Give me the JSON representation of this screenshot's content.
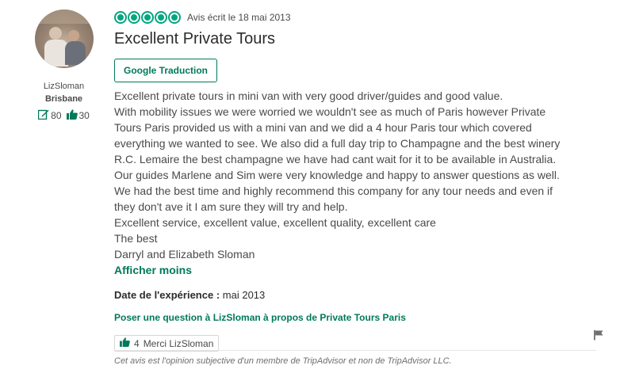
{
  "reviewer": {
    "username": "LizSloman",
    "location": "Brisbane",
    "review_count": "80",
    "helpful_count": "30"
  },
  "review": {
    "date_text": "Avis écrit le 18 mai 2013",
    "rating": 5,
    "title": "Excellent Private Tours",
    "translate_label": "Google Traduction",
    "body_lines": [
      "Excellent private tours in mini van with very good driver/guides and good value.",
      "With mobility issues we were worried we wouldn't see as much of Paris however Private",
      "Tours Paris provided us with a mini van and we did a 4 hour Paris tour which covered",
      "everything we wanted to see. We also did a full day trip to Champagne and the best winery",
      "R.C. Lemaire the best champagne we have had cant wait for it to be available in Australia.",
      "Our guides Marlene and Sim were very knowledge and happy to answer questions as well.",
      "We had the best time and highly recommend this company for any tour needs and even if",
      "they don't ave it I am sure they will try and help.",
      "Excellent service, excellent value, excellent quality, excellent care",
      "The best",
      "Darryl and Elizabeth Sloman"
    ],
    "show_less_label": "Afficher moins",
    "experience_label": "Date de l'expérience :",
    "experience_value": "mai 2013",
    "ask_question_label": "Poser une question à LizSloman à propos de Private Tours Paris",
    "helpful_votes": "4",
    "thank_label": "Merci LizSloman",
    "disclaimer": "Cet avis est l'opinion subjective d'un membre de TripAdvisor et non de TripAdvisor LLC."
  },
  "colors": {
    "accent": "#00a680",
    "link": "#00795a",
    "text": "#4a4a4a"
  },
  "icons": {
    "reviews": "edit-icon",
    "helpful": "thumbs-up-icon",
    "flag": "flag-icon"
  }
}
